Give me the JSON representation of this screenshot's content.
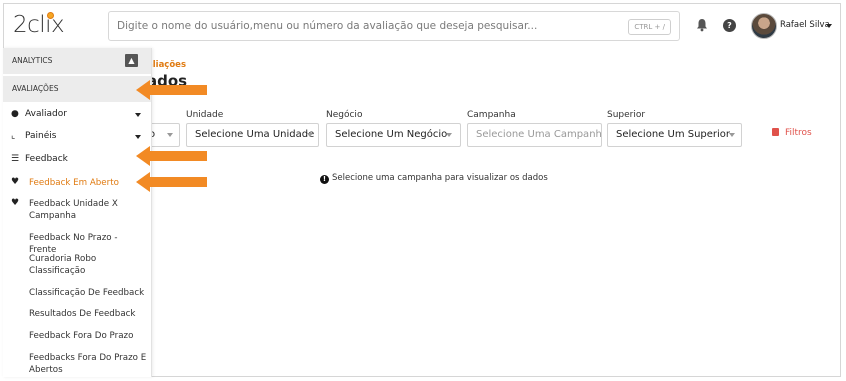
{
  "header": {
    "logo": "2clix",
    "search_placeholder": "Digite o nome do usuário,menu ou número da avaliação que deseja pesquisar...",
    "shortcut": "CTRL + /",
    "help": "?",
    "user_name": "Rafael Silva",
    "icons": [
      "bell-icon",
      "help-icon",
      "avatar",
      "chevron-down-icon"
    ]
  },
  "main": {
    "breadcrumb": "aliações",
    "title": "ados",
    "filters": {
      "partial_value": "o",
      "unidade": {
        "label": "Unidade",
        "value": "Selecione Uma Unidade"
      },
      "negocio": {
        "label": "Negócio",
        "value": "Selecione Um Negócio"
      },
      "campanha": {
        "label": "Campanha",
        "placeholder": "Selecione Uma Campanha"
      },
      "superior": {
        "label": "Superior",
        "value": "Selecione Um Superior"
      },
      "clear_label": "Filtros"
    },
    "info_message": "Selecione uma campanha para visualizar os dados"
  },
  "sidebar": {
    "section_analytics": "ANALYTICS",
    "section_avaliacoes": "AVALIAÇÕES",
    "items": [
      {
        "label": "Avaliador",
        "icon": "user-icon"
      },
      {
        "label": "Painéis",
        "icon": "chart-icon"
      },
      {
        "label": "Feedback",
        "icon": "comments-icon"
      }
    ],
    "subitems": [
      {
        "label": "Feedback Em Aberto"
      },
      {
        "label": "Feedback Unidade X Campanha"
      },
      {
        "label": "Feedback No Prazo - Frente"
      },
      {
        "label": "Curadoria Robo Classificação"
      },
      {
        "label": "Classificação De Feedback"
      },
      {
        "label": "Resultados De Feedback"
      },
      {
        "label": "Feedback Fora Do Prazo"
      },
      {
        "label": "Feedbacks Fora Do Prazo E Abertos"
      }
    ]
  },
  "colors": {
    "accent": "#e07b12",
    "arrow": "#f28a24",
    "danger": "#e0524b"
  }
}
